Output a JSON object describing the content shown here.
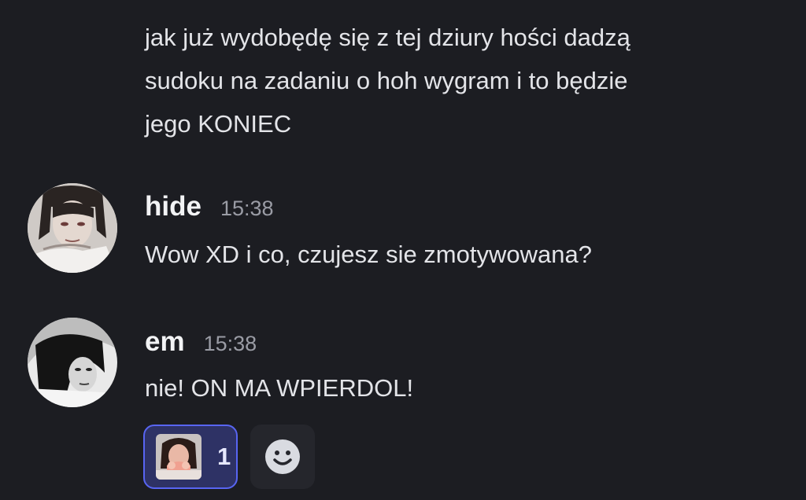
{
  "messages": {
    "continued": {
      "text": "jak już wydobędę się z tej dziury hości dadzą\nsudoku na zadaniu o hoh wygram i to będzie\njego KONIEC"
    },
    "hide": {
      "username": "hide",
      "time": "15:38",
      "text": "Wow XD i co, czujesz sie zmotywowana?"
    },
    "em": {
      "username": "em",
      "time": "15:38",
      "text": "nie! ON MA WPIERDOL!"
    }
  },
  "reactions": [
    {
      "emoji": "custom-face-emoji",
      "count": "1"
    }
  ],
  "colors": {
    "background": "#1c1d22",
    "reaction_border": "#5865f2",
    "reaction_bg": "#2e3265"
  }
}
